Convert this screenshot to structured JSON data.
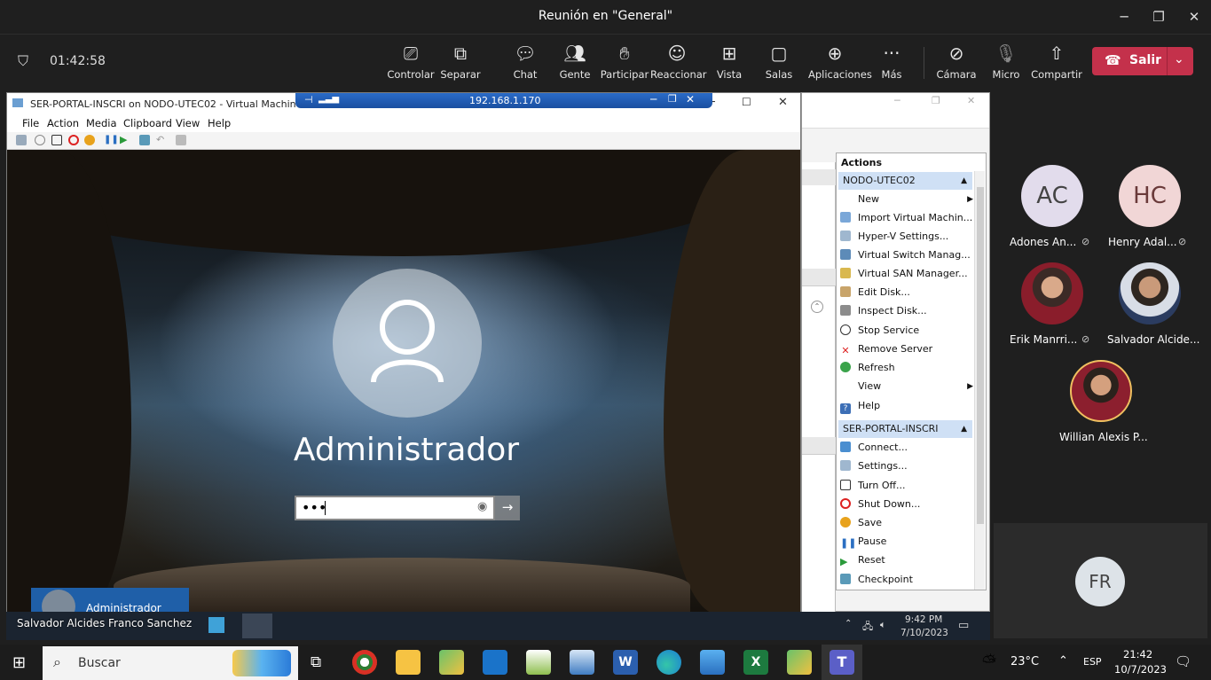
{
  "window": {
    "title": "Reunión en \"General\""
  },
  "meeting": {
    "timer": "01:42:58",
    "buttons": [
      {
        "label": "Controlar",
        "icon": "control-icon"
      },
      {
        "label": "Separar",
        "icon": "popout-icon"
      },
      {
        "label": "Chat",
        "icon": "chat-icon"
      },
      {
        "label": "Gente",
        "icon": "people-icon"
      },
      {
        "label": "Participar",
        "icon": "raise-hand-icon"
      },
      {
        "label": "Reaccionar",
        "icon": "smiley-icon"
      },
      {
        "label": "Vista",
        "icon": "grid-icon"
      },
      {
        "label": "Salas",
        "icon": "rooms-icon"
      },
      {
        "label": "Aplicaciones",
        "icon": "plus-icon"
      },
      {
        "label": "Más",
        "icon": "more-icon"
      },
      {
        "label": "Cámara",
        "icon": "camera-off-icon"
      },
      {
        "label": "Micro",
        "icon": "mic-off-icon"
      },
      {
        "label": "Compartir",
        "icon": "share-icon"
      }
    ],
    "leave_label": "Salir"
  },
  "vm": {
    "title": "SER-PORTAL-INSCRI on NODO-UTEC02 - Virtual Machine Conne",
    "menu": [
      "File",
      "Action",
      "Media",
      "Clipboard",
      "View",
      "Help"
    ],
    "rdp_ip": "192.168.1.170",
    "user_name": "Administrador",
    "password_mask": "•••",
    "corner_user": "Administrador"
  },
  "hyperv": {
    "actions_title": "Actions",
    "sections": [
      {
        "header": "NODO-UTEC02",
        "items": [
          "New",
          "Import Virtual Machin...",
          "Hyper-V Settings...",
          "Virtual Switch Manag...",
          "Virtual SAN Manager...",
          "Edit Disk...",
          "Inspect Disk...",
          "Stop Service",
          "Remove Server",
          "Refresh",
          "View",
          "Help"
        ]
      },
      {
        "header": "SER-PORTAL-INSCRI",
        "items": [
          "Connect...",
          "Settings...",
          "Turn Off...",
          "Shut Down...",
          "Save",
          "Pause",
          "Reset",
          "Checkpoint"
        ]
      }
    ]
  },
  "participants": [
    {
      "initials": "AC",
      "name": "Adones An...",
      "muted": true,
      "color": "#e8e2f0"
    },
    {
      "initials": "HC",
      "name": "Henry Adal...",
      "muted": true,
      "color": "#f3dcdc"
    },
    {
      "initials": "",
      "name": "Erik Manrri...",
      "muted": true
    },
    {
      "initials": "",
      "name": "Salvador Alcide...",
      "muted": false
    },
    {
      "initials": "",
      "name": "Willian Alexis P...",
      "muted": false
    },
    {
      "initials": "FR",
      "name": "",
      "muted": false
    }
  ],
  "presenter": "Salvador Alcides Franco Sanchez",
  "inner_clock": {
    "time": "9:42 PM",
    "date": "7/10/2023"
  },
  "taskbar": {
    "search_placeholder": "Buscar",
    "weather": "23°C",
    "lang": "ESP",
    "time": "21:42",
    "date": "10/7/2023"
  }
}
